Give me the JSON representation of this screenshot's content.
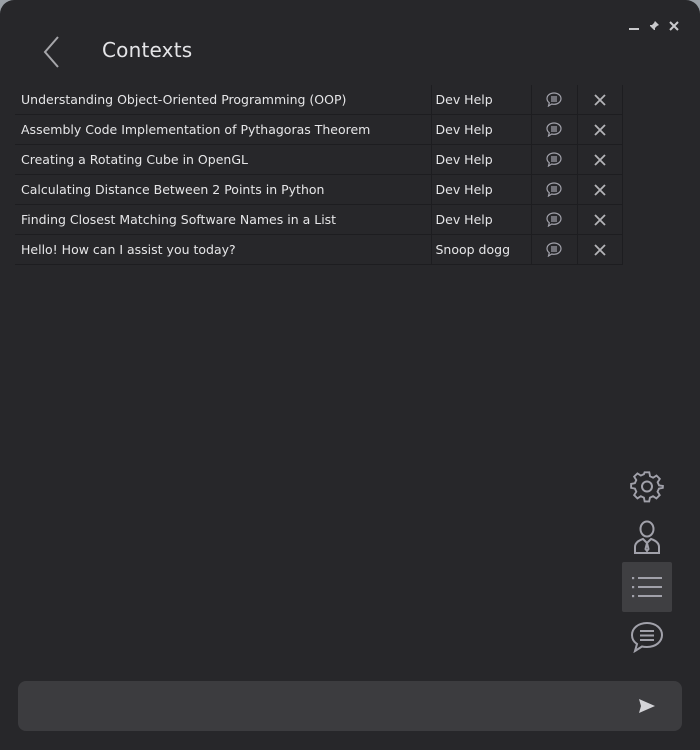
{
  "header": {
    "title": "Contexts"
  },
  "contexts": [
    {
      "title": "Understanding Object-Oriented Programming (OOP)",
      "context": "Dev Help"
    },
    {
      "title": "Assembly Code Implementation of Pythagoras Theorem",
      "context": "Dev Help"
    },
    {
      "title": "Creating a Rotating Cube in OpenGL",
      "context": "Dev Help"
    },
    {
      "title": "Calculating Distance Between 2 Points in Python",
      "context": "Dev Help"
    },
    {
      "title": "Finding Closest Matching Software Names in a List",
      "context": "Dev Help"
    },
    {
      "title": "Hello! How can I assist you today?",
      "context": "Snoop dogg"
    }
  ],
  "sidebar": {
    "items": [
      {
        "icon": "gear-icon"
      },
      {
        "icon": "agent-icon"
      },
      {
        "icon": "list-icon",
        "active": true
      },
      {
        "icon": "chat-bubble-icon"
      }
    ]
  },
  "composer": {
    "value": "",
    "placeholder": ""
  },
  "colors": {
    "background": "#27272a",
    "panel": "#3c3c3f",
    "active": "#3f3f42",
    "text": "#e6e6e8",
    "icon": "#a1a1aa"
  }
}
